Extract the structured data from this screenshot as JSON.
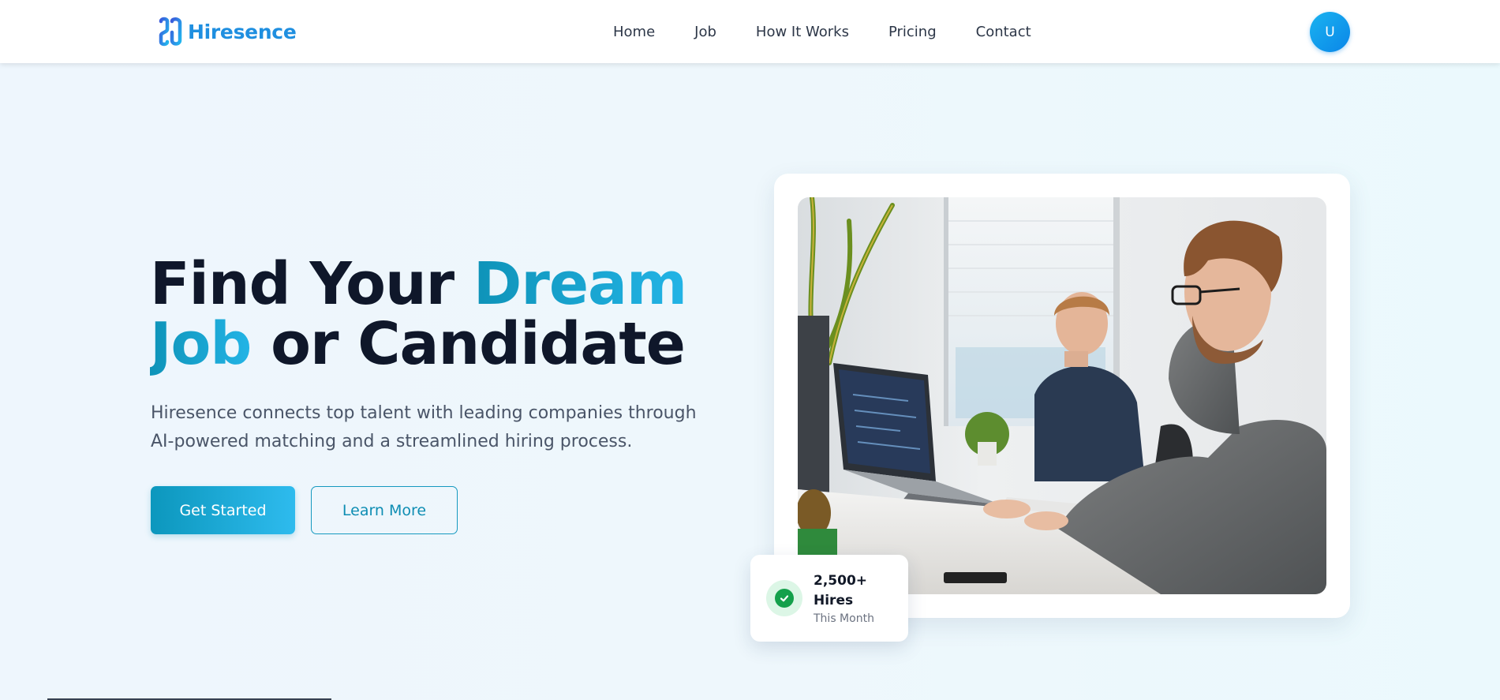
{
  "brand": {
    "name": "Hiresence",
    "primary_color": "#1f8fe0",
    "accent_gradient": [
      "#0e93b8",
      "#23b4e6"
    ]
  },
  "nav": {
    "links": [
      {
        "label": "Home"
      },
      {
        "label": "Job"
      },
      {
        "label": "How It Works"
      },
      {
        "label": "Pricing"
      },
      {
        "label": "Contact"
      }
    ],
    "avatar_initial": "U"
  },
  "hero": {
    "title_part1": "Find Your ",
    "title_accent1": "Dream",
    "title_accent2": "Job",
    "title_part2": " or Candidate",
    "subtitle": "Hiresence connects top talent with leading companies through AI-powered matching and a streamlined hiring process.",
    "primary_button": "Get Started",
    "secondary_button": "Learn More"
  },
  "stat_card": {
    "value": "2,500+ Hires",
    "label": "This Month",
    "icon": "check-circle-icon"
  },
  "image": {
    "description_icon": "office-photo"
  }
}
